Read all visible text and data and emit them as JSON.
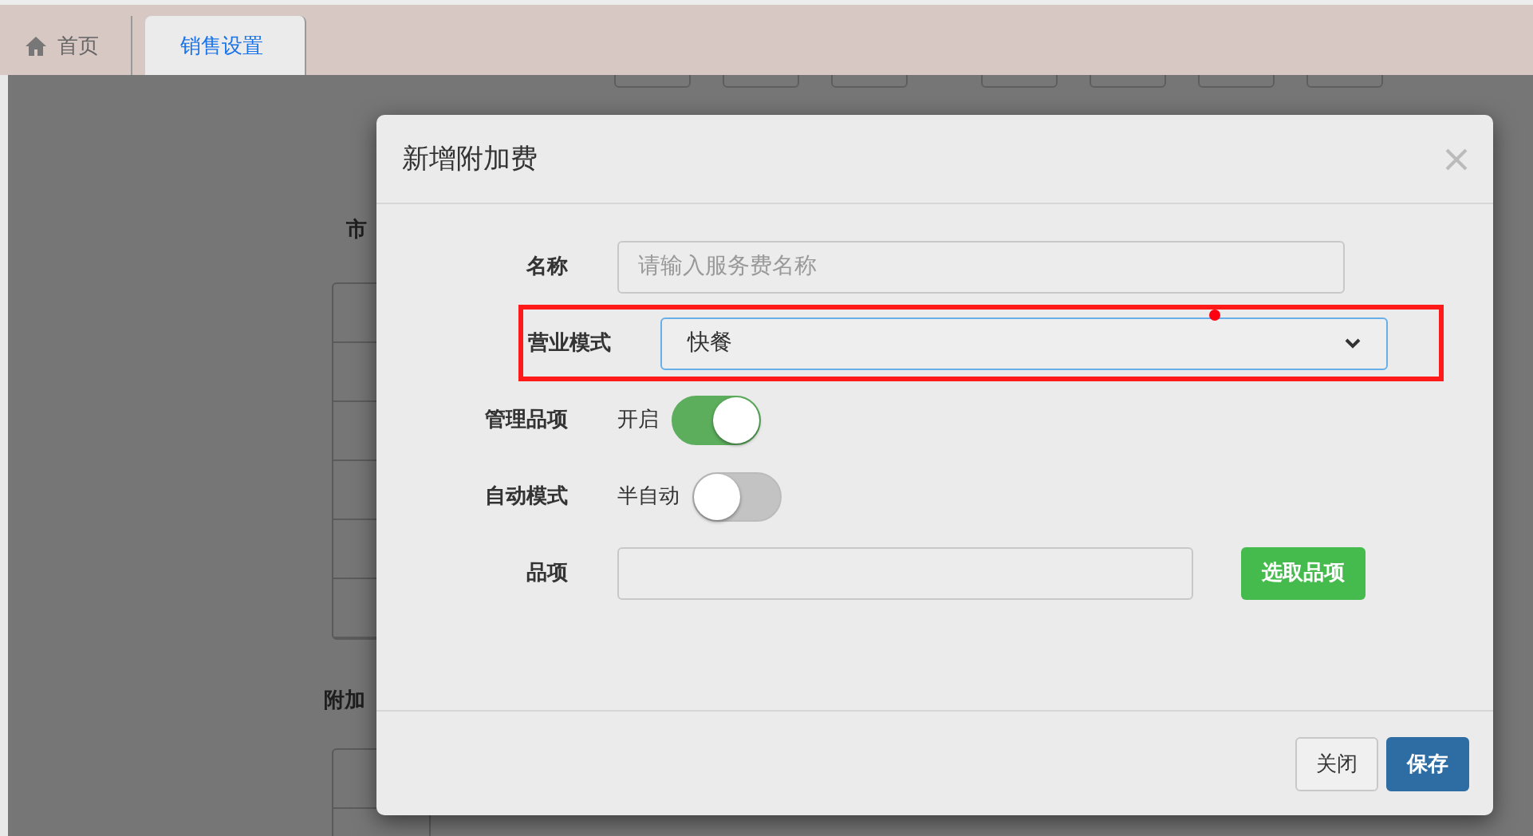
{
  "tabs": [
    {
      "label": "首页",
      "selected": false
    },
    {
      "label": "销售设置",
      "selected": true
    }
  ],
  "background": {
    "section_1": {
      "label": "市"
    },
    "section_2": {
      "label": "附加"
    }
  },
  "dialog": {
    "title": "新增附加费",
    "fields": [
      {
        "kind": "input",
        "label": "名称",
        "placeholder": "请输入服务费名称",
        "highlighted": false
      },
      {
        "kind": "select",
        "label": "营业模式",
        "value": "快餐",
        "highlighted": true
      },
      {
        "kind": "switch",
        "label": "管理品项",
        "state_label": "开启",
        "on": true
      },
      {
        "kind": "switch",
        "label": "自动模式",
        "state_label": "半自动",
        "on": false
      },
      {
        "kind": "picker",
        "label": "品项",
        "button": "选取品项"
      }
    ],
    "buttons": [
      {
        "label": "关闭",
        "kind": "default"
      },
      {
        "label": "保存",
        "kind": "primary"
      }
    ]
  }
}
